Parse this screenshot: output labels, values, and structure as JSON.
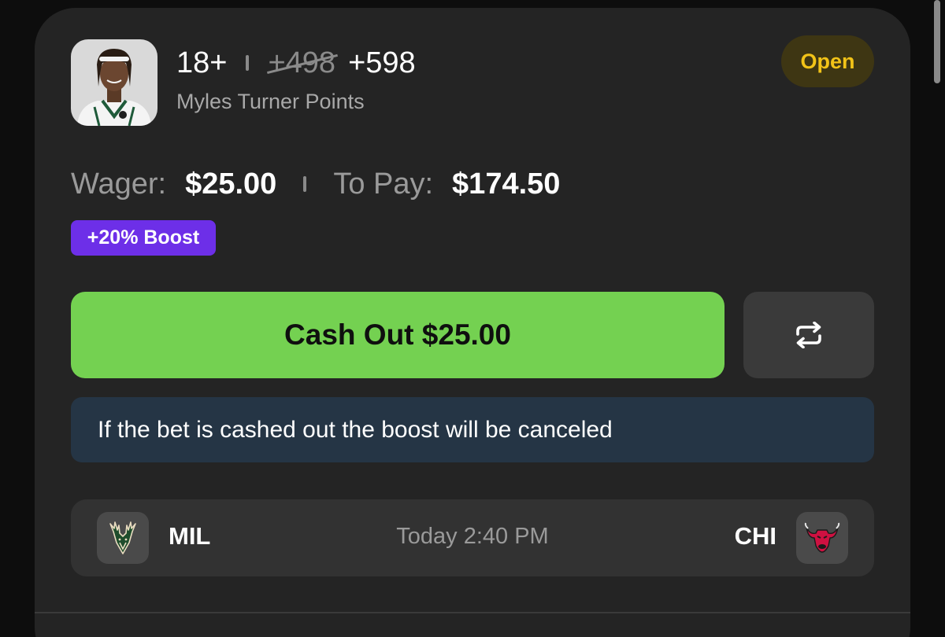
{
  "bet": {
    "line": "18+",
    "old_odds": "+498",
    "new_odds": "+598",
    "market": "Myles Turner Points",
    "status": "Open"
  },
  "wager": {
    "wager_label": "Wager:",
    "wager_value": "$25.00",
    "to_pay_label": "To Pay:",
    "to_pay_value": "$174.50"
  },
  "boost": {
    "label": "+20% Boost"
  },
  "actions": {
    "cashout_label": "Cash Out $25.00",
    "repeat_icon": "repeat-arrows-icon"
  },
  "info": {
    "message": "If the bet is cashed out the boost will be canceled"
  },
  "game": {
    "home_team": "MIL",
    "away_team": "CHI",
    "time": "Today 2:40 PM",
    "home_logo_icon": "bucks-logo-icon",
    "away_logo_icon": "bulls-logo-icon"
  },
  "colors": {
    "cashout_green": "#74d151",
    "boost_purple": "#6d2fe8",
    "status_yellow": "#f2c318",
    "status_bg": "#3e3613",
    "info_bg": "#253545",
    "card_bg": "#242424"
  }
}
